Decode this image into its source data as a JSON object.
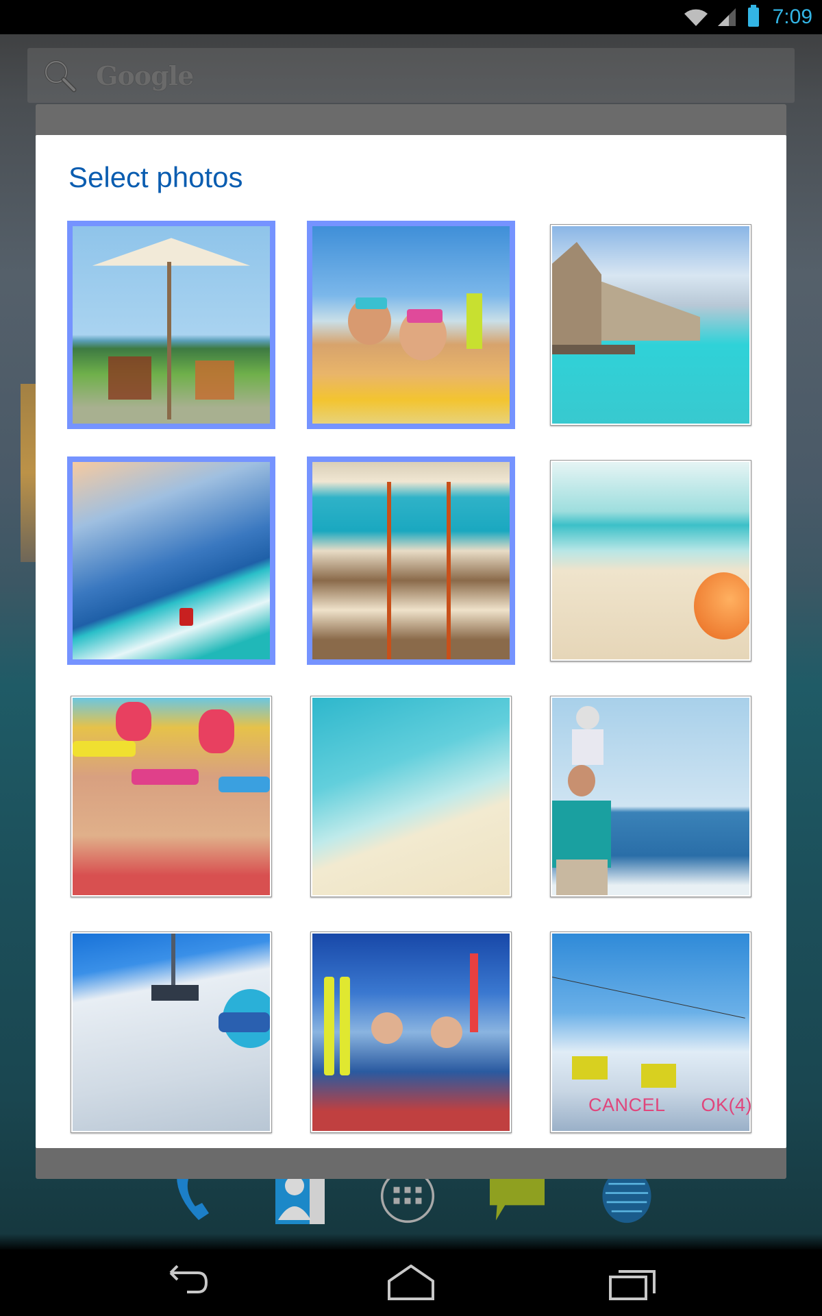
{
  "status_bar": {
    "time": "7:09",
    "icons": [
      "wifi-icon",
      "signal-icon",
      "battery-icon"
    ],
    "accent_color": "#33b5e5"
  },
  "search": {
    "label": "Google",
    "icon": "search-icon"
  },
  "dialog": {
    "title": "Select photos",
    "title_color": "#0b5db0",
    "selection_color": "#7593ff",
    "photos": [
      {
        "subject": "Beach umbrella and chairs under palm trees",
        "selected": true
      },
      {
        "subject": "Kids snorkeling on inflatable",
        "selected": true
      },
      {
        "subject": "Overwater villas",
        "selected": false
      },
      {
        "subject": "Jet ski on waves at sunset",
        "selected": true
      },
      {
        "subject": "Beach loungers and boats",
        "selected": true
      },
      {
        "subject": "Seashell on sandy beach",
        "selected": false
      },
      {
        "subject": "Kids with snorkel masks",
        "selected": false
      },
      {
        "subject": "Clear water on shoreline",
        "selected": false
      },
      {
        "subject": "Father carrying child on shoulders by sea",
        "selected": false
      },
      {
        "subject": "Skier on chairlift",
        "selected": false
      },
      {
        "subject": "Family skiing in mountains",
        "selected": false
      },
      {
        "subject": "Ski gondola over mountains",
        "selected": false
      }
    ],
    "selected_count": 4,
    "buttons": {
      "cancel": "CANCEL",
      "ok": "OK(4)",
      "color": "#e0457b"
    }
  },
  "dock": {
    "apps": [
      "phone-icon",
      "contacts-icon",
      "app-drawer-icon",
      "messaging-icon",
      "browser-icon"
    ]
  },
  "nav_bar": {
    "buttons": [
      "back-icon",
      "home-icon",
      "recents-icon"
    ]
  }
}
